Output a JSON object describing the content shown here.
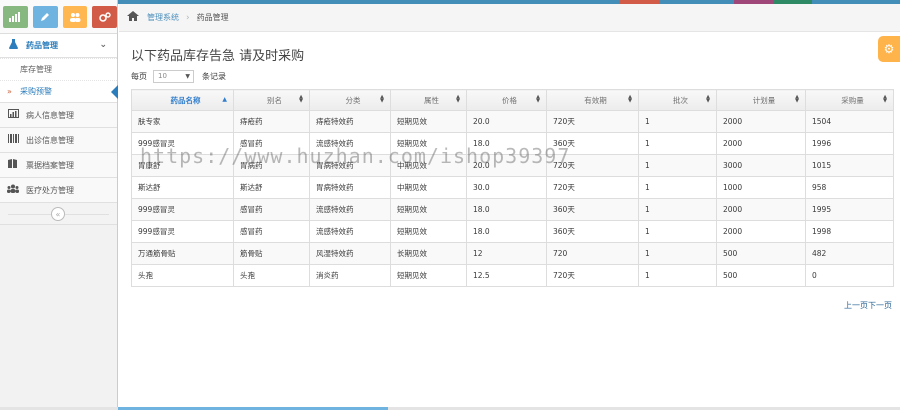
{
  "colors": {
    "brand": "#438eb9",
    "accent": "#2b7dbc",
    "shortcut_green": "#87b87f",
    "shortcut_blue": "#6fb3e0",
    "shortcut_orange": "#ffb752",
    "shortcut_red": "#d15b47",
    "warning": "#ffb44b"
  },
  "shortcuts": [
    {
      "icon": "signal-icon",
      "color": "#87b87f"
    },
    {
      "icon": "pencil-icon",
      "color": "#6fb3e0"
    },
    {
      "icon": "users-icon",
      "color": "#ffb752"
    },
    {
      "icon": "cogs-icon",
      "color": "#d15b47"
    }
  ],
  "sidebar": {
    "menu_open": {
      "label": "药品管理",
      "icon": "flask-icon"
    },
    "submenu": [
      {
        "label": "库存管理"
      },
      {
        "label": "采购预警"
      }
    ],
    "items": [
      {
        "label": "病人信息管理",
        "icon": "chart-icon"
      },
      {
        "label": "出诊信息管理",
        "icon": "barcode-icon"
      },
      {
        "label": "票据档案管理",
        "icon": "book-icon"
      },
      {
        "label": "医疗处方管理",
        "icon": "group-icon"
      }
    ]
  },
  "breadcrumb": {
    "home_icon": "home-icon",
    "link": "管理系统",
    "current": "药品管理"
  },
  "main": {
    "title": "以下药品库存告急 请及时采购",
    "length_prefix": "每页",
    "length_value": "10",
    "length_suffix": "条记录",
    "pager": "上一页下一页"
  },
  "table": {
    "columns": [
      "药品名称",
      "别名",
      "分类",
      "属性",
      "价格",
      "有效期",
      "批次",
      "计划量",
      "采购量"
    ],
    "rows": [
      [
        "肤专家",
        "痔疮药",
        "痔疮特效药",
        "短期见效",
        "20.0",
        "720天",
        "1",
        "2000",
        "1504"
      ],
      [
        "999感冒灵",
        "感冒药",
        "流感特效药",
        "短期见效",
        "18.0",
        "360天",
        "1",
        "2000",
        "1996"
      ],
      [
        "胃康舒",
        "胃病药",
        "胃病特效药",
        "中期见效",
        "20.0",
        "720天",
        "1",
        "3000",
        "1015"
      ],
      [
        "斯达舒",
        "斯达舒",
        "胃病特效药",
        "中期见效",
        "30.0",
        "720天",
        "1",
        "1000",
        "958"
      ],
      [
        "999感冒灵",
        "感冒药",
        "流感特效药",
        "短期见效",
        "18.0",
        "360天",
        "1",
        "2000",
        "1995"
      ],
      [
        "999感冒灵",
        "感冒药",
        "流感特效药",
        "短期见效",
        "18.0",
        "360天",
        "1",
        "2000",
        "1998"
      ],
      [
        "万通筋骨贴",
        "筋骨贴",
        "风湿特效药",
        "长期见效",
        "12",
        "720",
        "1",
        "500",
        "482"
      ],
      [
        "头孢",
        "头孢",
        "消炎药",
        "短期见效",
        "12.5",
        "720天",
        "1",
        "500",
        "0"
      ]
    ]
  },
  "watermark": "https://www.huzhan.com/ishop39397"
}
